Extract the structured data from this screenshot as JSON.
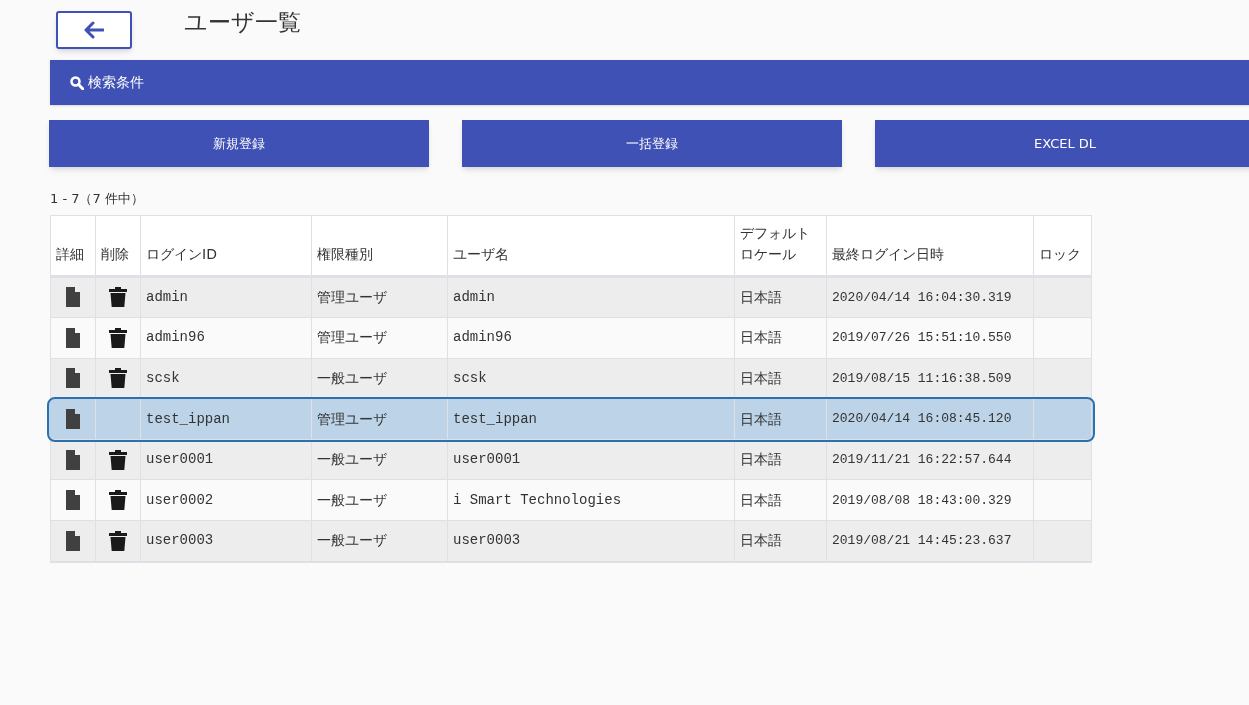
{
  "page": {
    "title": "ユーザ一覧"
  },
  "search_panel": {
    "label": "検索条件"
  },
  "buttons": [
    "新規登録",
    "一括登録",
    "EXCEL DL"
  ],
  "result_count": "1 - 7（7 件中）",
  "table": {
    "columns": [
      "詳細",
      "削除",
      "ログインID",
      "権限種別",
      "ユーザ名",
      "デフォルトロケール",
      "最終ログイン日時",
      "ロック"
    ],
    "rows": [
      {
        "login_id": "admin",
        "role": "管理ユーザ",
        "user_name": "admin",
        "locale": "日本語",
        "last_login": "2020/04/14 16:04:30.319",
        "deletable": true,
        "selected": false
      },
      {
        "login_id": "admin96",
        "role": "管理ユーザ",
        "user_name": "admin96",
        "locale": "日本語",
        "last_login": "2019/07/26 15:51:10.550",
        "deletable": true,
        "selected": false
      },
      {
        "login_id": "scsk",
        "role": "一般ユーザ",
        "user_name": "scsk",
        "locale": "日本語",
        "last_login": "2019/08/15 11:16:38.509",
        "deletable": true,
        "selected": false
      },
      {
        "login_id": "test_ippan",
        "role": "管理ユーザ",
        "user_name": "test_ippan",
        "locale": "日本語",
        "last_login": "2020/04/14 16:08:45.120",
        "deletable": false,
        "selected": true
      },
      {
        "login_id": "user0001",
        "role": "一般ユーザ",
        "user_name": "user0001",
        "locale": "日本語",
        "last_login": "2019/11/21 16:22:57.644",
        "deletable": true,
        "selected": false
      },
      {
        "login_id": "user0002",
        "role": "一般ユーザ",
        "user_name": "i Smart Technologies",
        "locale": "日本語",
        "last_login": "2019/08/08 18:43:00.329",
        "deletable": true,
        "selected": false
      },
      {
        "login_id": "user0003",
        "role": "一般ユーザ",
        "user_name": "user0003",
        "locale": "日本語",
        "last_login": "2019/08/21 14:45:23.637",
        "deletable": true,
        "selected": false
      }
    ]
  }
}
